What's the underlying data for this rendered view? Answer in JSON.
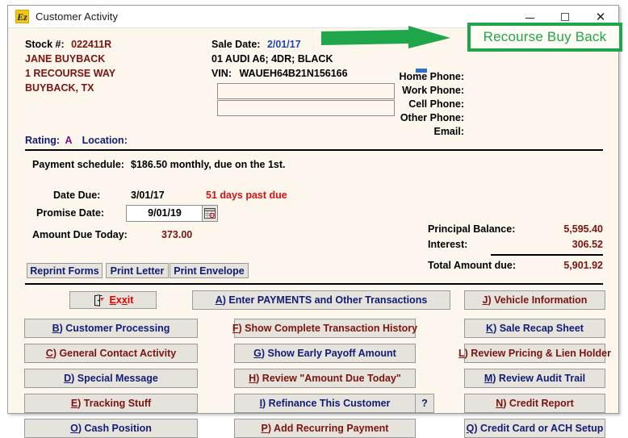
{
  "window": {
    "title": "Customer Activity",
    "icon": "Ez",
    "controls": {
      "minimize": "minimize-icon",
      "maximize": "maximize-icon",
      "close": "✕"
    }
  },
  "customer": {
    "stock_label": "Stock #:",
    "stock_value": "022411R",
    "name": "JANE BUYBACK",
    "address": "1 RECOURSE WAY",
    "city_state": "BUYBACK, TX",
    "rating_label": "Rating:",
    "rating_value": "A",
    "location_label": "Location:"
  },
  "vehicle": {
    "sale_date_label": "Sale Date:",
    "sale_date_value": "2/01/17",
    "description": "01 AUDI A6; 4DR; BLACK",
    "vin_label": "VIN:",
    "vin_value": "WAUEH64B21N156166",
    "free_field_1": "",
    "free_field_2": ""
  },
  "contact": {
    "labels": [
      "Home Phone:",
      "Work Phone:",
      "Cell Phone:",
      "Other Phone:",
      "Email:"
    ]
  },
  "payment": {
    "schedule_label": "Payment schedule:",
    "schedule_value": "$186.50 monthly, due on the 1st.",
    "date_due_label": "Date Due:",
    "date_due_value": "3/01/17",
    "past_due_text": "51 days past due",
    "promise_label": "Promise Date:",
    "promise_value": "9/01/19",
    "amount_due_label": "Amount Due Today:",
    "amount_due_value": "373.00"
  },
  "balances": {
    "principal_label": "Principal Balance:",
    "principal_value": "5,595.40",
    "interest_label": "Interest:",
    "interest_value": "306.52",
    "total_label": "Total Amount due:",
    "total_value": "5,901.92"
  },
  "print_buttons": [
    {
      "label": "Reprint Forms"
    },
    {
      "label": "Print Letter"
    },
    {
      "label": "Print Envelope"
    }
  ],
  "exit_button": {
    "accel": "E",
    "pre": "E",
    "mid": "x",
    "post": "it",
    "full": "Exit"
  },
  "actions": {
    "a": {
      "key": "A",
      "text": ") Enter PAYMENTS and Other Transactions",
      "color": "navy"
    },
    "b": {
      "key": "B",
      "text": ") Customer Processing",
      "color": "navy"
    },
    "c": {
      "key": "C",
      "text": ") General Contact Activity",
      "color": "red"
    },
    "d": {
      "key": "D",
      "text": ") Special Message",
      "color": "navy"
    },
    "e": {
      "key": "E",
      "text": ") Tracking Stuff",
      "color": "red"
    },
    "f": {
      "key": "F",
      "text": ") Show Complete Transaction History",
      "color": "red"
    },
    "g": {
      "key": "G",
      "text": ") Show Early Payoff Amount",
      "color": "navy"
    },
    "h": {
      "key": "H",
      "text": ") Review \"Amount Due Today\"",
      "color": "red"
    },
    "i": {
      "key": "I",
      "text": ") Refinance This Customer",
      "color": "navy"
    },
    "j": {
      "key": "J",
      "text": ") Vehicle Information",
      "color": "red"
    },
    "k": {
      "key": "K",
      "text": ") Sale Recap Sheet",
      "color": "navy"
    },
    "l": {
      "key": "L",
      "text": ") Review Pricing & Lien Holder",
      "color": "red"
    },
    "m": {
      "key": "M",
      "text": ") Review Audit Trail",
      "color": "navy"
    },
    "n": {
      "key": "N",
      "text": ") Credit Report",
      "color": "red"
    },
    "o": {
      "key": "O",
      "text": ") Cash Position",
      "color": "navy"
    },
    "p": {
      "key": "P",
      "text": ") Add Recurring Payment",
      "color": "red"
    },
    "q": {
      "key": "Q",
      "text": ") Credit Card or ACH Setup",
      "color": "navy"
    },
    "help": {
      "label": "?"
    }
  },
  "annotation": {
    "callout_text": "Recourse Buy Back",
    "color": "#1fa64a"
  }
}
